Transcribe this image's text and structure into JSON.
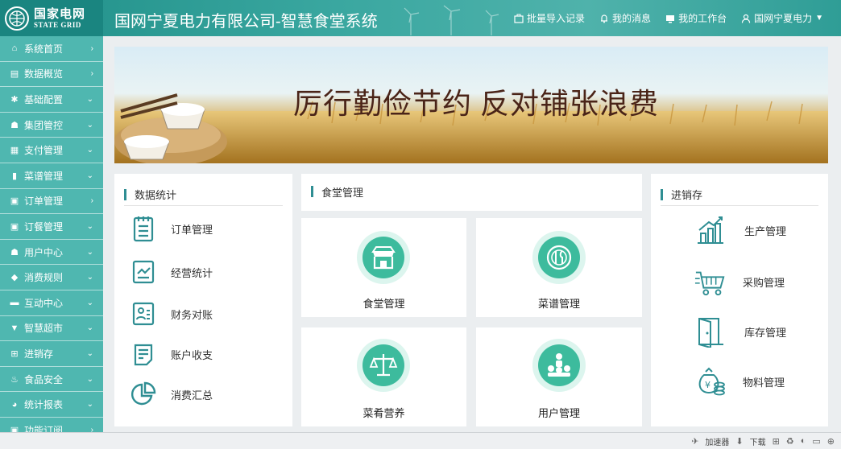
{
  "header": {
    "logo_cn": "国家电网",
    "logo_en": "STATE GRID",
    "title": "国网宁夏电力有限公司-智慧食堂系统",
    "actions": [
      {
        "label": "批量导入记录",
        "icon": "import-icon"
      },
      {
        "label": "我的消息",
        "icon": "bell-icon"
      },
      {
        "label": "我的工作台",
        "icon": "workbench-icon"
      },
      {
        "label": "国网宁夏电力",
        "icon": "user-icon"
      }
    ]
  },
  "sidebar": {
    "items": [
      {
        "label": "系统首页",
        "icon": "home-icon",
        "glyph": "⌂",
        "arrow": "›"
      },
      {
        "label": "数据概览",
        "icon": "chart-icon",
        "glyph": "▤",
        "arrow": "›"
      },
      {
        "label": "基础配置",
        "icon": "gear-icon",
        "glyph": "✱",
        "arrow": "⌄"
      },
      {
        "label": "集团管控",
        "icon": "group-icon",
        "glyph": "☗",
        "arrow": "⌄"
      },
      {
        "label": "支付管理",
        "icon": "payment-icon",
        "glyph": "▦",
        "arrow": "⌄"
      },
      {
        "label": "菜谱管理",
        "icon": "menu-book-icon",
        "glyph": "▮",
        "arrow": "⌄"
      },
      {
        "label": "订单管理",
        "icon": "order-icon",
        "glyph": "▣",
        "arrow": "›"
      },
      {
        "label": "订餐管理",
        "icon": "meal-order-icon",
        "glyph": "▣",
        "arrow": "⌄"
      },
      {
        "label": "用户中心",
        "icon": "user-icon",
        "glyph": "☗",
        "arrow": "⌄"
      },
      {
        "label": "消费规则",
        "icon": "tag-icon",
        "glyph": "◆",
        "arrow": "⌄"
      },
      {
        "label": "互动中心",
        "icon": "chat-icon",
        "glyph": "▬",
        "arrow": "⌄"
      },
      {
        "label": "智慧超市",
        "icon": "basket-icon",
        "glyph": "▼",
        "arrow": "⌄"
      },
      {
        "label": "进销存",
        "icon": "cart-icon",
        "glyph": "⊞",
        "arrow": "⌄"
      },
      {
        "label": "食品安全",
        "icon": "food-safety-icon",
        "glyph": "♨",
        "arrow": "⌄"
      },
      {
        "label": "统计报表",
        "icon": "pie-icon",
        "glyph": "◕",
        "arrow": "⌄"
      },
      {
        "label": "功能订阅",
        "icon": "subscribe-icon",
        "glyph": "▣",
        "arrow": "›"
      }
    ]
  },
  "banner": {
    "slogan": "厉行勤俭节约  反对铺张浪费"
  },
  "data_stats": {
    "title": "数据统计",
    "items": [
      {
        "label": "订单管理",
        "icon": "clipboard-icon"
      },
      {
        "label": "经营统计",
        "icon": "trend-chart-icon"
      },
      {
        "label": "财务对账",
        "icon": "id-card-icon"
      },
      {
        "label": "账户收支",
        "icon": "ledger-icon"
      },
      {
        "label": "消费汇总",
        "icon": "pie-chart-icon"
      }
    ]
  },
  "canteen": {
    "title": "食堂管理",
    "cards": [
      {
        "label": "食堂管理",
        "icon": "storefront-icon"
      },
      {
        "label": "菜谱管理",
        "icon": "dinner-plate-icon"
      },
      {
        "label": "菜肴营养",
        "icon": "scale-icon"
      },
      {
        "label": "用户管理",
        "icon": "users-group-icon"
      }
    ]
  },
  "inventory": {
    "title": "进销存",
    "items": [
      {
        "label": "生产管理",
        "icon": "growth-chart-icon"
      },
      {
        "label": "采购管理",
        "icon": "shopping-cart-icon"
      },
      {
        "label": "库存管理",
        "icon": "door-icon"
      },
      {
        "label": "物料管理",
        "icon": "money-bag-icon"
      }
    ]
  },
  "statusbar": {
    "accelerator": "加速器",
    "download": "下载"
  }
}
